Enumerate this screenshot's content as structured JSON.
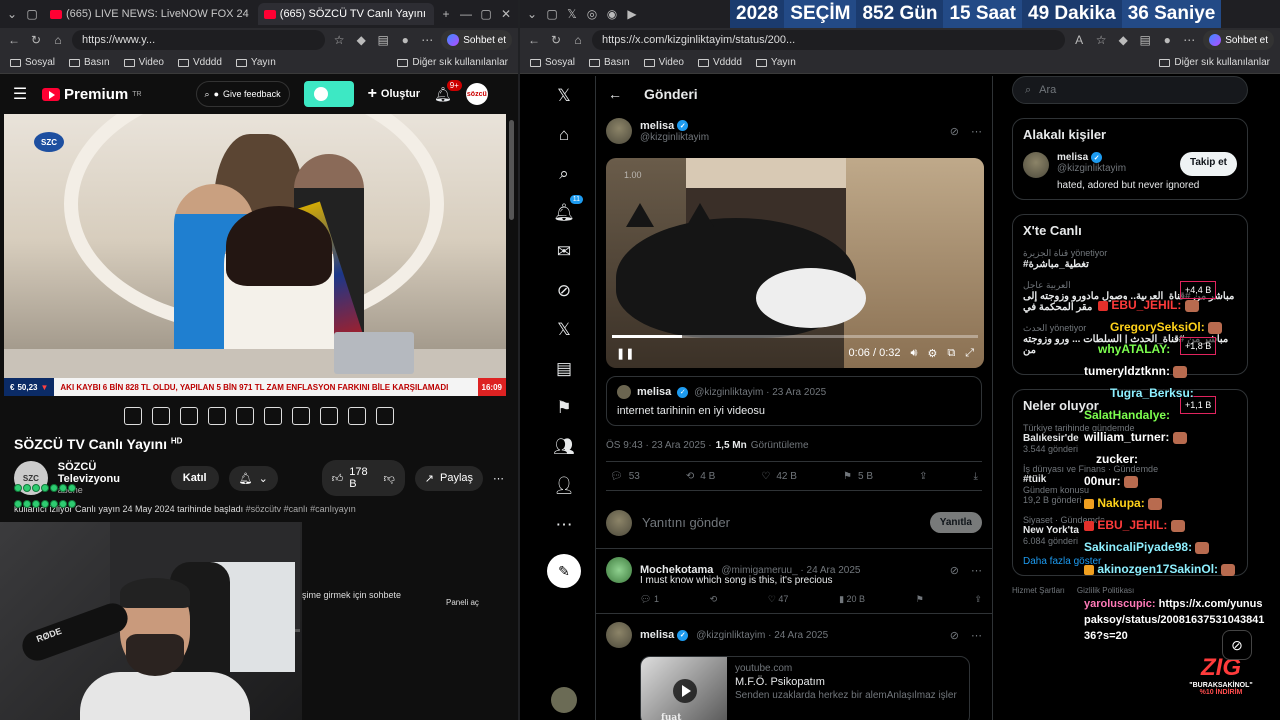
{
  "left_browser": {
    "tabs": [
      {
        "label": "(665) LIVE NEWS: LiveNOW FOX 24",
        "active": false
      },
      {
        "label": "(665) SÖZCÜ TV Canlı Yayını",
        "active": true
      }
    ],
    "url": "https://www.y...",
    "chat_button": "Sohbet et",
    "bookmarks": [
      "Sosyal",
      "Basın",
      "Video",
      "Vdddd",
      "Yayın"
    ],
    "bookmarks_other": "Diğer sık kullanılanlar"
  },
  "youtube": {
    "logo": "Premium",
    "logo_region": "TR",
    "feedback_label": "Give feedback",
    "create_label": "Oluştur",
    "notif_count": "9+",
    "avatar_label": "sözcü",
    "channel_logo": "SZC",
    "ticker": {
      "index_value": "50,23",
      "message": "AKI KAYBI 6 BİN 828 TL OLDU, YAPILAN 5 BİN 971 TL ZAM ENFLASYON FARKINI BİLE KARŞILAMADI",
      "brand": "SZC",
      "time": "16:09"
    },
    "title": "SÖZCÜ TV Canlı Yayını",
    "title_badge": "HD",
    "channel_name": "SÖZCÜ Televizyonu",
    "subscribers": "abone",
    "join_label": "Katıl",
    "likes": "178 B",
    "share_label": "Paylaş",
    "desc_text": "kullanıcı izliyor  Canlı yayın 24 May 2024 tarihinde başladı",
    "desc_tags": "#sözcütv #canlı #canlıyayın",
    "chat_hint": "şime girmek için sohbete",
    "panel_label": "Paneli aç",
    "mic_brand": "RØDE"
  },
  "right_browser": {
    "url": "https://x.com/kizginliktayim/status/200...",
    "chat_button": "Sohbet et",
    "bookmarks": [
      "Sosyal",
      "Basın",
      "Video",
      "Vdddd",
      "Yayın"
    ],
    "bookmarks_other": "Diğer sık kullanılanlar",
    "countdown": [
      "2028",
      "SEÇİM",
      "852 Gün",
      "15 Saat",
      "49 Dakika",
      "36 Saniye"
    ]
  },
  "x": {
    "notif_badge": "11",
    "header_title": "Gönderi",
    "post": {
      "name": "melisa",
      "handle": "@kizginliktayim",
      "video_speed": "1.00",
      "video_time": "0:06 / 0:32",
      "video_progress": 0.19,
      "quote_name": "melisa",
      "quote_handle": "@kizginliktayim · 23 Ara 2025",
      "quote_text": "internet tarihinin en iyi videosu",
      "time": "ÖS 9:43 · 23 Ara 2025 ·",
      "views": "1,5 Mn",
      "views_label": "Görüntüleme",
      "replies": "53",
      "reposts": "4 B",
      "likes": "42 B",
      "bookmarks": "5 B"
    },
    "reply_placeholder": "Yanıtını gönder",
    "reply_button": "Yanıtla",
    "replies": [
      {
        "name": "Mochekotama",
        "handle": "@mimigameruu_ · 24 Ara 2025",
        "text": "I must know which song is this, it's precious",
        "replies": "1",
        "likes": "47",
        "views": "20 B"
      },
      {
        "name": "melisa",
        "handle": "@kizginliktayim · 24 Ara 2025",
        "card_domain": "youtube.com",
        "card_title": "M.F.Ö. Psikopatım",
        "card_desc": "Senden uzaklarda herkez bir alemAnlaşılmaz işler",
        "card_thumb_text": "fuat"
      }
    ],
    "search_placeholder": "Ara",
    "related": {
      "title": "Alakalı kişiler",
      "name": "melisa",
      "handle": "@kizginliktayim",
      "bio": "hated, adored but never ignored",
      "follow": "Takip et"
    },
    "live": {
      "title": "X'te Canlı",
      "items": [
        {
          "host": "قناة الجزيرة",
          "role": "yönetiyor",
          "title": "#تغطية_مباشرة"
        },
        {
          "host": "العربية عاجل",
          "role": "yönetiyor",
          "title": "مباشر من #قناة_العربية.. وصول مادورو وزوجته إلى مقر المحكمة في"
        },
        {
          "host": "الحدث",
          "role": "yönetiyor",
          "title": "مباشر من #قناة_الحدث | السلطات ... ورو وزوجته من"
        }
      ]
    },
    "trends": {
      "title": "Neler oluyor",
      "items": [
        {
          "cat": "Türkiye tarihinde gündemde",
          "name": "Balıkesir'de",
          "posts": "3.544 gönderi"
        },
        {
          "cat": "İş dünyası ve Finans · Gündemde",
          "name": "#tüik",
          "posts": "Gündem konusu"
        },
        {
          "cat": "",
          "name": "",
          "posts": "19,2 B gönderi"
        },
        {
          "cat": "Siyaset · Gündemde",
          "name": "New York'ta",
          "posts": "6.084 gönderi"
        }
      ],
      "more": "Daha fazla göster"
    },
    "footer": [
      "Hizmet Şartları",
      "Gizlilik Politikası"
    ]
  },
  "stream_overlay": {
    "live_counts": [
      "+4,4 B",
      "+1,8 B",
      "+1,1 B"
    ],
    "chat": [
      {
        "user": "EBU_JEHIL:",
        "color": "red",
        "text": ""
      },
      {
        "user": "GregorySeksiOl:",
        "color": "yel",
        "text": ""
      },
      {
        "user": "whyATALAY:",
        "color": "grn",
        "text": ""
      },
      {
        "user": "tumeryldztknn:",
        "color": "wh",
        "text": ""
      },
      {
        "user": "Tugra_Berksu:",
        "color": "cy",
        "text": ""
      },
      {
        "user": "SalatHandalye:",
        "color": "grn",
        "text": ""
      },
      {
        "user": "william_turner:",
        "color": "wh",
        "text": ""
      },
      {
        "user": "zucker:",
        "color": "wh",
        "text": ""
      },
      {
        "user": "00nur:",
        "color": "wh",
        "text": ""
      },
      {
        "user": "Nakupa:",
        "color": "yel",
        "text": ""
      },
      {
        "user": "EBU_JEHIL:",
        "color": "red",
        "text": ""
      },
      {
        "user": "SakincaliPiyade98:",
        "color": "cy",
        "text": ""
      },
      {
        "user": "akinozgen17SakinOl:",
        "color": "cy",
        "text": ""
      },
      {
        "user": "yaroluscupic:",
        "color": "pk",
        "text": "https://x.com/yunus"
      },
      {
        "user": "",
        "color": "wh",
        "text": "paksoy/status/20081637531043841"
      },
      {
        "user": "",
        "color": "wh",
        "text": "36?s=20"
      }
    ],
    "promo_brand": "ZIG",
    "promo_line1": "\"BURAKSAKİNOL\"",
    "promo_line2": "%10 İNDİRİM"
  }
}
